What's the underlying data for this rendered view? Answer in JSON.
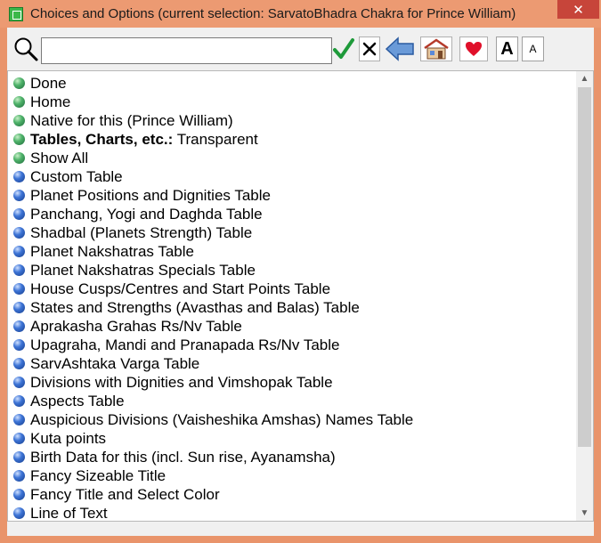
{
  "window": {
    "title": "Choices and Options (current selection: SarvatoBhadra Chakra for Prince William)",
    "close_label": "✕"
  },
  "toolbar": {
    "search_value": "",
    "font_larger_label": "A",
    "font_smaller_label": "A"
  },
  "list": {
    "items": [
      {
        "label": "Done",
        "color": "green"
      },
      {
        "label": "Home",
        "color": "green"
      },
      {
        "label": "Native for this (Prince William)",
        "color": "green"
      },
      {
        "label_bold": "Tables, Charts, etc.:",
        "label": " Transparent",
        "color": "green"
      },
      {
        "label": "Show All",
        "color": "green"
      },
      {
        "label": "Custom Table",
        "color": "blue"
      },
      {
        "label": "Planet Positions and Dignities Table",
        "color": "blue"
      },
      {
        "label": "Panchang, Yogi and Daghda Table",
        "color": "blue"
      },
      {
        "label": "Shadbal (Planets Strength) Table",
        "color": "blue"
      },
      {
        "label": "Planet Nakshatras Table",
        "color": "blue"
      },
      {
        "label": "Planet Nakshatras Specials Table",
        "color": "blue"
      },
      {
        "label": "House Cusps/Centres and Start Points Table",
        "color": "blue"
      },
      {
        "label": "States and Strengths (Avasthas and Balas) Table",
        "color": "blue"
      },
      {
        "label": "Aprakasha Grahas Rs/Nv Table",
        "color": "blue"
      },
      {
        "label": "Upagraha, Mandi and Pranapada Rs/Nv Table",
        "color": "blue"
      },
      {
        "label": "SarvAshtaka Varga Table",
        "color": "blue"
      },
      {
        "label": "Divisions with Dignities and Vimshopak Table",
        "color": "blue"
      },
      {
        "label": "Aspects Table",
        "color": "blue"
      },
      {
        "label": "Auspicious Divisions (Vaisheshika Amshas) Names Table",
        "color": "blue"
      },
      {
        "label": "Kuta points",
        "color": "blue"
      },
      {
        "label": "Birth Data for this (incl. Sun rise, Ayanamsha)",
        "color": "blue"
      },
      {
        "label": "Fancy Sizeable Title",
        "color": "blue"
      },
      {
        "label": "Fancy Title and Select Color",
        "color": "blue"
      },
      {
        "label": "Line of Text",
        "color": "blue"
      }
    ]
  },
  "colors": {
    "window_frame": "#e9946b",
    "close_button": "#c7453a",
    "bullet_green": "#4fb36a",
    "bullet_blue": "#3d74d6"
  },
  "icons": {
    "search": "magnifier-icon",
    "ok": "checkmark-icon",
    "cancel": "x-icon",
    "back": "back-arrow-icon",
    "home": "house-icon",
    "favorite": "heart-icon"
  }
}
